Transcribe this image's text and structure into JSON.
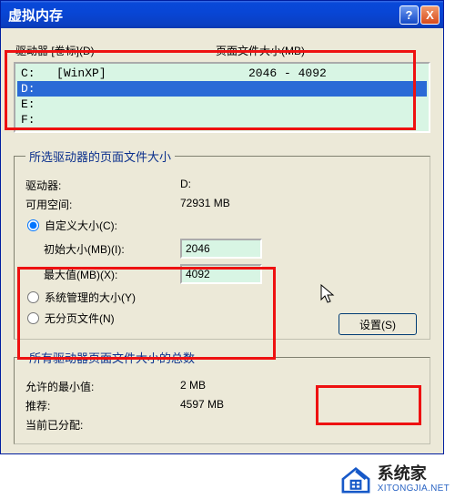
{
  "window": {
    "title": "虚拟内存",
    "help_glyph": "?",
    "close_glyph": "X"
  },
  "columns": {
    "drive": "驱动器 [卷标](D)",
    "pagefile": "页面文件大小(MB)"
  },
  "drives": [
    {
      "letter": "C:",
      "label": "[WinXP]",
      "pagefile": "2046 - 4092",
      "selected": false
    },
    {
      "letter": "D:",
      "label": "",
      "pagefile": "",
      "selected": true
    },
    {
      "letter": "E:",
      "label": "",
      "pagefile": "",
      "selected": false
    },
    {
      "letter": "F:",
      "label": "",
      "pagefile": "",
      "selected": false
    }
  ],
  "selected_drive_section": {
    "legend": "所选驱动器的页面文件大小",
    "drive_label": "驱动器:",
    "drive_value": "D:",
    "free_label": "可用空间:",
    "free_value": "72931 MB",
    "radio_custom": "自定义大小(C):",
    "initial_label": "初始大小(MB)(I):",
    "initial_value": "2046",
    "max_label": "最大值(MB)(X):",
    "max_value": "4092",
    "radio_system": "系统管理的大小(Y)",
    "radio_none": "无分页文件(N)",
    "set_button": "设置(S)",
    "checked": "custom"
  },
  "totals_section": {
    "legend": "所有驱动器页面文件大小的总数",
    "min_label": "允许的最小值:",
    "min_value": "2 MB",
    "rec_label": "推荐:",
    "rec_value": "4597 MB",
    "cur_label": "当前已分配:"
  },
  "watermark": {
    "cn": "系统家",
    "url": "XITONGJIA.NET"
  },
  "highlight_color": "#e11"
}
